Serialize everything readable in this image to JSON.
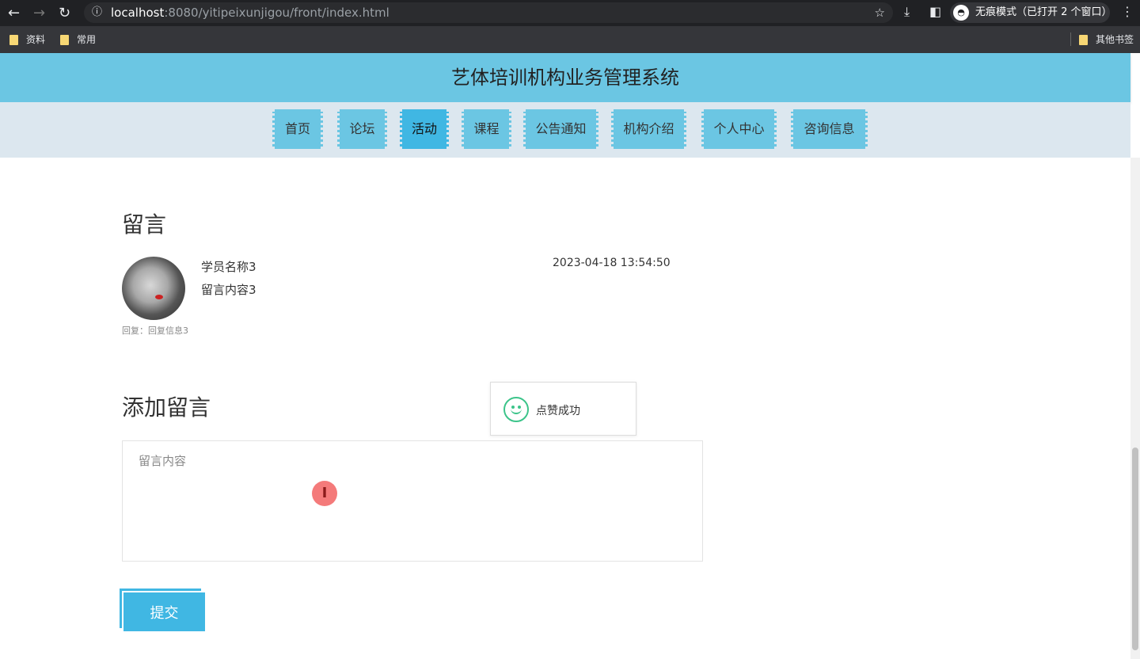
{
  "browser": {
    "url_host": "localhost",
    "url_rest": ":8080/yitipeixunjigou/front/index.html",
    "incognito_label": "无痕模式（已打开 2 个窗口）",
    "bookmarks": [
      "资料",
      "常用"
    ],
    "other_bookmarks": "其他书签"
  },
  "header": {
    "title": "艺体培训机构业务管理系统"
  },
  "nav": {
    "items": [
      "首页",
      "论坛",
      "活动",
      "课程",
      "公告通知",
      "机构介绍",
      "个人中心",
      "咨询信息"
    ],
    "active": "活动"
  },
  "comments": {
    "title": "留言",
    "items": [
      {
        "name": "学员名称3",
        "content": "留言内容3",
        "time": "2023-04-18 13:54:50",
        "reply": "回复：回复信息3"
      }
    ]
  },
  "add_comment": {
    "title": "添加留言",
    "placeholder": "留言内容",
    "submit_label": "提交"
  },
  "toast": {
    "message": "点赞成功"
  },
  "colors": {
    "header": "#6bc6e3",
    "accent": "#40b7e3",
    "success": "#3cc48a"
  }
}
